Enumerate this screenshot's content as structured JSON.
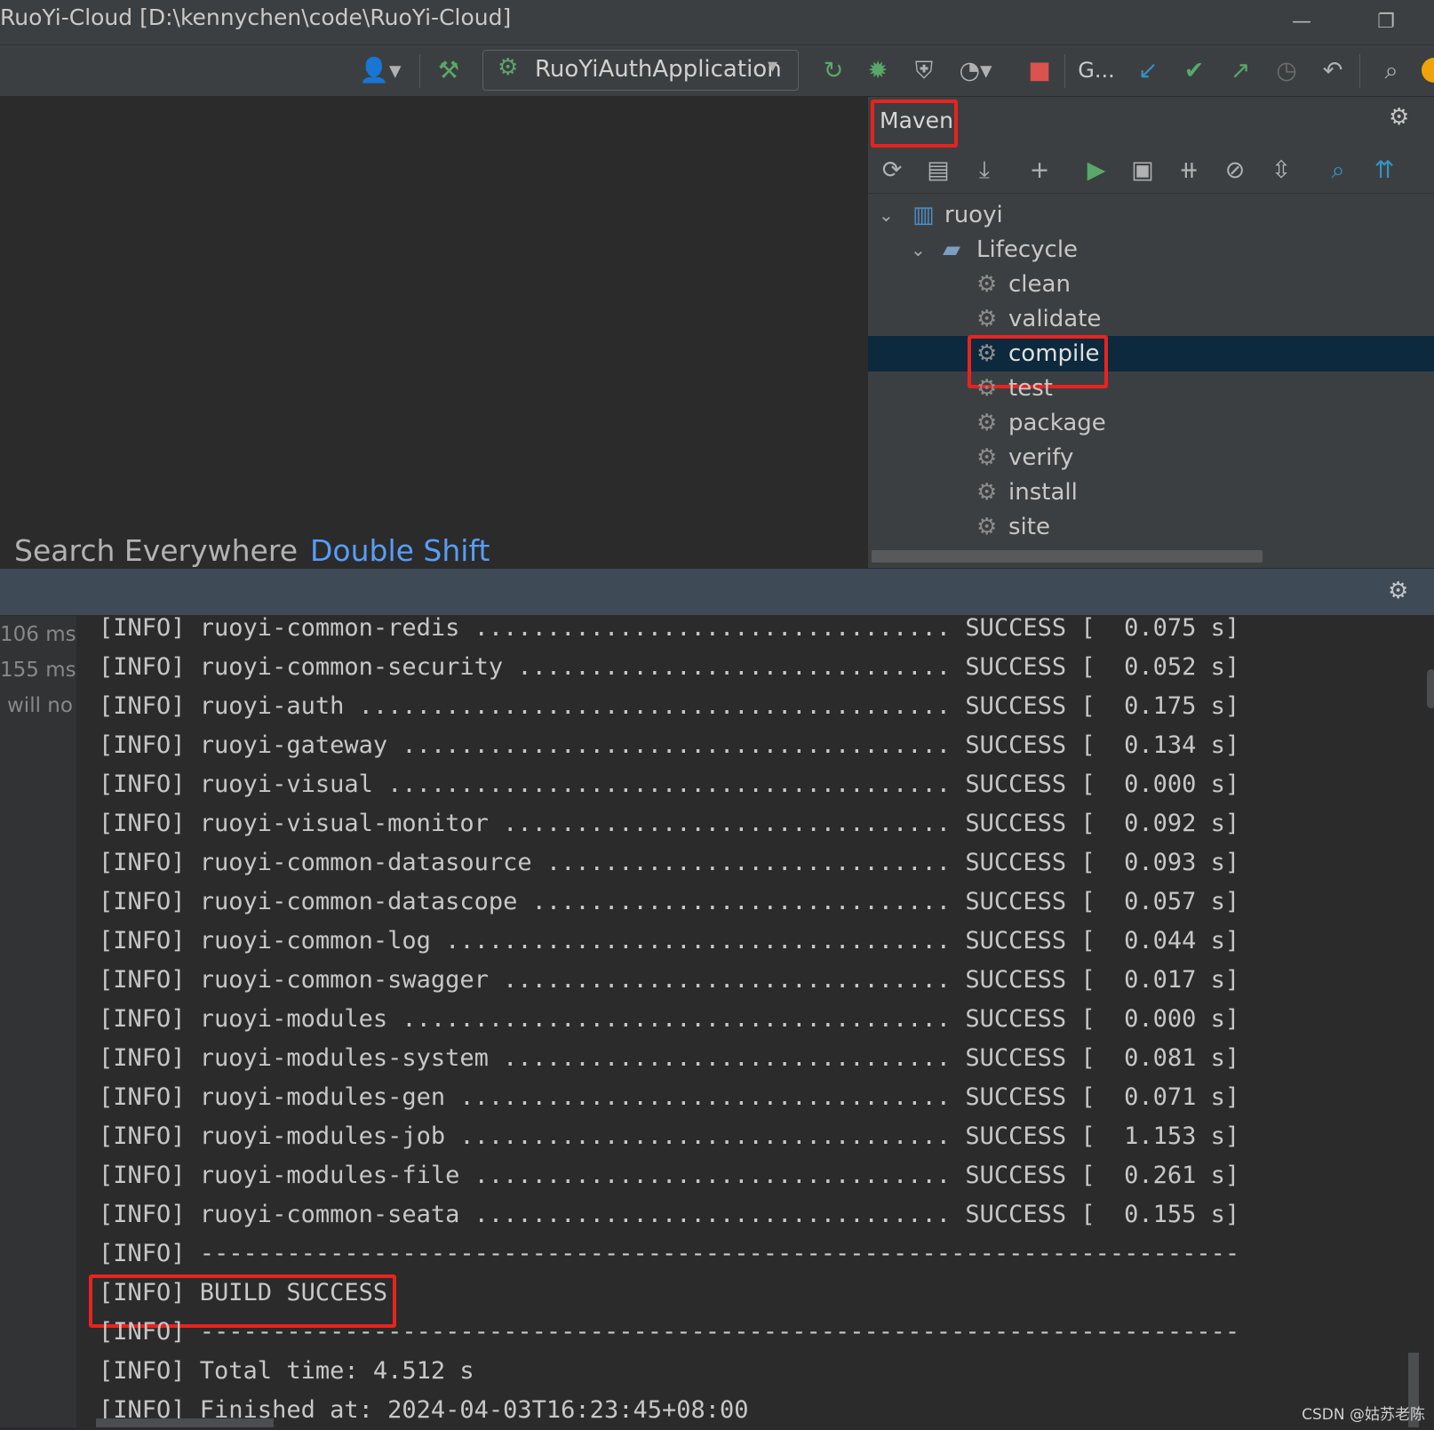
{
  "window": {
    "title": "RuoYi-Cloud [D:\\kennychen\\code\\RuoYi-Cloud]",
    "minimize_glyph": "—",
    "restore_glyph": "❐"
  },
  "toolbar": {
    "run_config": "RuoYiAuthApplication",
    "git_label": "G...",
    "icons": [
      "user-icon",
      "hammer-icon",
      "rerun-icon",
      "debug-icon",
      "coverage-icon",
      "profile-icon",
      "stop-icon",
      "git-update-icon",
      "git-commit-icon",
      "git-push-icon",
      "history-icon",
      "rollback-icon",
      "search-icon"
    ]
  },
  "editor": {
    "search_hint": "Search Everywhere",
    "search_shortcut": "Double Shift"
  },
  "maven": {
    "title": "Maven",
    "project": "ruoyi",
    "lifecycle": "Lifecycle",
    "phases": [
      "clean",
      "validate",
      "compile",
      "test",
      "package",
      "verify",
      "install",
      "site"
    ],
    "selected_phase": "compile"
  },
  "run": {
    "gutter": [
      "106 ms",
      "155 ms",
      "will no"
    ],
    "lines": [
      "[INFO] ruoyi-common-redis ................................. SUCCESS [  0.075 s]",
      "[INFO] ruoyi-common-security .............................. SUCCESS [  0.052 s]",
      "[INFO] ruoyi-auth ......................................... SUCCESS [  0.175 s]",
      "[INFO] ruoyi-gateway ...................................... SUCCESS [  0.134 s]",
      "[INFO] ruoyi-visual ....................................... SUCCESS [  0.000 s]",
      "[INFO] ruoyi-visual-monitor ............................... SUCCESS [  0.092 s]",
      "[INFO] ruoyi-common-datasource ............................ SUCCESS [  0.093 s]",
      "[INFO] ruoyi-common-datascope ............................. SUCCESS [  0.057 s]",
      "[INFO] ruoyi-common-log ................................... SUCCESS [  0.044 s]",
      "[INFO] ruoyi-common-swagger ............................... SUCCESS [  0.017 s]",
      "[INFO] ruoyi-modules ...................................... SUCCESS [  0.000 s]",
      "[INFO] ruoyi-modules-system ............................... SUCCESS [  0.081 s]",
      "[INFO] ruoyi-modules-gen .................................. SUCCESS [  0.071 s]",
      "[INFO] ruoyi-modules-job .................................. SUCCESS [  1.153 s]",
      "[INFO] ruoyi-modules-file ................................. SUCCESS [  0.261 s]",
      "[INFO] ruoyi-common-seata ................................. SUCCESS [  0.155 s]",
      "[INFO] ------------------------------------------------------------------------",
      "[INFO] BUILD SUCCESS",
      "[INFO] ------------------------------------------------------------------------",
      "[INFO] Total time: 4.512 s",
      "[INFO] Finished at: 2024-04-03T16:23:45+08:00"
    ]
  },
  "watermark": "CSDN @姑苏老陈",
  "colors": {
    "highlight_box": "#e8231f",
    "selection": "#0d293e",
    "shortcut": "#589df6",
    "run_green": "#4caf50"
  }
}
